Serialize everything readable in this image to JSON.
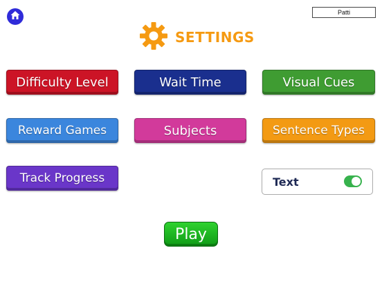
{
  "header": {
    "user_name": "Patti",
    "title": "SETTINGS",
    "icons": {
      "home": "home-icon",
      "settings": "gear-icon"
    }
  },
  "buttons": [
    {
      "label": "Difficulty Level",
      "color": "#cc1426"
    },
    {
      "label": "Wait Time",
      "color": "#1a2f8e"
    },
    {
      "label": "Visual Cues",
      "color": "#3f9c32"
    },
    {
      "label": "Reward Games",
      "color": "#3b86dd"
    },
    {
      "label": "Subjects",
      "color": "#d23a9b"
    },
    {
      "label": "Sentence Types",
      "color": "#f39a13"
    },
    {
      "label": "Track Progress",
      "color": "#6a36c9"
    }
  ],
  "toggle": {
    "label": "Text",
    "on": true,
    "color": "#37b24d"
  },
  "play_label": "Play",
  "colors": {
    "accent": "#f59a12",
    "home": "#2f2bd9"
  }
}
